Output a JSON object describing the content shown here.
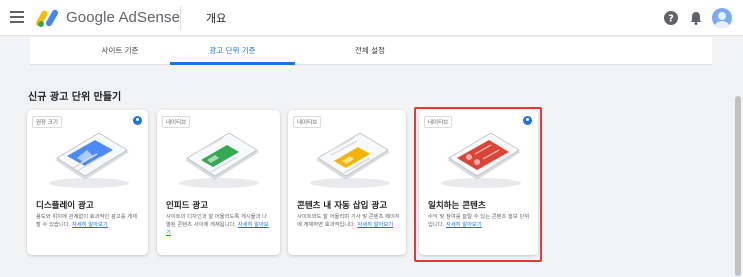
{
  "header": {
    "brand_google": "Google",
    "brand_adsense": "AdSense",
    "page_name": "개요"
  },
  "tabs": [
    {
      "label": "사이트 기준"
    },
    {
      "label": "광고 단위 기준"
    },
    {
      "label": "전체 설정"
    }
  ],
  "section_title": "신규 광고 단위 만들기",
  "cards": [
    {
      "badge": "권장 크기",
      "title": "디스플레이 광고",
      "desc": "용도와 위치에 관계없이 효과적인 광고를 게재할 수 있습니다.",
      "link": "자세히 알아보기"
    },
    {
      "badge": "네이티브",
      "title": "인피드 광고",
      "desc": "사이트의 디자인과 잘 어울리도록 게시물과 나열된 콘텐츠 사이에 게재됩니다.",
      "link": "자세히 알아보기"
    },
    {
      "badge": "네이티브",
      "title": "콘텐츠 내 자동 삽입 광고",
      "desc": "사이트와도 잘 어울리며 기사 및 콘텐츠 페이지에 게재하면 효과적입니다.",
      "link": "자세히 알아보기"
    },
    {
      "badge": "네이티브",
      "title": "일치하는 콘텐츠",
      "desc": "수익 및 참여를 늘릴 수 있는 콘텐츠 홍보 단위입니다.",
      "link": "자세히 알아보기"
    }
  ],
  "colors": {
    "accent": "#1a73e8",
    "highlight": "#e53935",
    "display_ad": "#4c8bf5",
    "infeed_ad": "#34a853",
    "inarticle_ad": "#f4b400",
    "matched_content": "#db4437"
  },
  "icons": [
    "menu-icon",
    "adsense-logo-icon",
    "help-icon",
    "bell-icon",
    "avatar",
    "info-icon"
  ]
}
